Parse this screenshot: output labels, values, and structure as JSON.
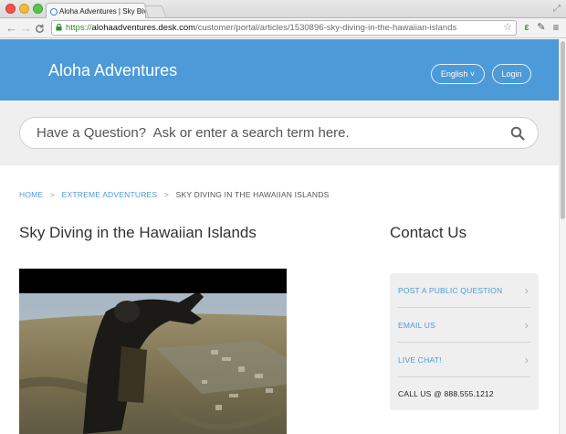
{
  "browser": {
    "tab_title": "Aloha Adventures | Sky Div",
    "tab_close": "×",
    "url_scheme": "https://",
    "url_host": "alohaadventures.desk.com",
    "url_path": "/customer/portal/articles/1530896-sky-diving-in-the-hawaiian-islands",
    "nav": {
      "back": "←",
      "forward": "→",
      "reload": "C"
    },
    "star_icon": "☆",
    "menu_icon": "≡"
  },
  "header": {
    "site_title": "Aloha Adventures",
    "language_label": "English ˅",
    "login_label": "Login"
  },
  "search": {
    "placeholder": "Have a Question?  Ask or enter a search term here."
  },
  "breadcrumb": {
    "home": "HOME",
    "separator": ">",
    "category": "EXTREME ADVENTURES",
    "current": "SKY DIVING IN THE HAWAIIAN ISLANDS"
  },
  "article": {
    "title": "Sky Diving in the Hawaiian Islands"
  },
  "sidebar": {
    "title": "Contact Us",
    "items": [
      {
        "label": "POST A PUBLIC QUESTION",
        "chevron": "›"
      },
      {
        "label": "EMAIL US",
        "chevron": "›"
      },
      {
        "label": "LIVE CHAT!",
        "chevron": "›"
      }
    ],
    "call_text": "CALL US @ 888.555.1212"
  },
  "colors": {
    "brand_blue": "#4c9ad8",
    "panel_gray": "#efefef"
  }
}
